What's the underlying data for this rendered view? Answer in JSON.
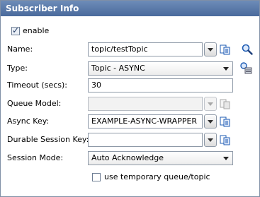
{
  "header": {
    "title": "Subscriber Info"
  },
  "enable": {
    "label": "enable",
    "checked": true
  },
  "fields": {
    "name": {
      "label": "Name:",
      "value": "topic/testTopic"
    },
    "type": {
      "label": "Type:",
      "value": "Topic - ASYNC"
    },
    "timeout": {
      "label": "Timeout (secs):",
      "value": "30"
    },
    "queue_model": {
      "label": "Queue Model:",
      "value": ""
    },
    "async_key": {
      "label": "Async Key:",
      "value": "EXAMPLE-ASYNC-WRAPPER"
    },
    "durable_session_key": {
      "label": "Durable Session Key:",
      "value": ""
    },
    "session_mode": {
      "label": "Session Mode:",
      "value": "Auto Acknowledge"
    }
  },
  "temp_queue": {
    "label": "use temporary queue/topic",
    "checked": false
  },
  "colors": {
    "header_bg": "#5678a8",
    "icon_blue": "#1d5bb3"
  },
  "icons": [
    "dropdown-arrow-icon",
    "copy-icon",
    "search-icon",
    "browse-queue-icon"
  ]
}
